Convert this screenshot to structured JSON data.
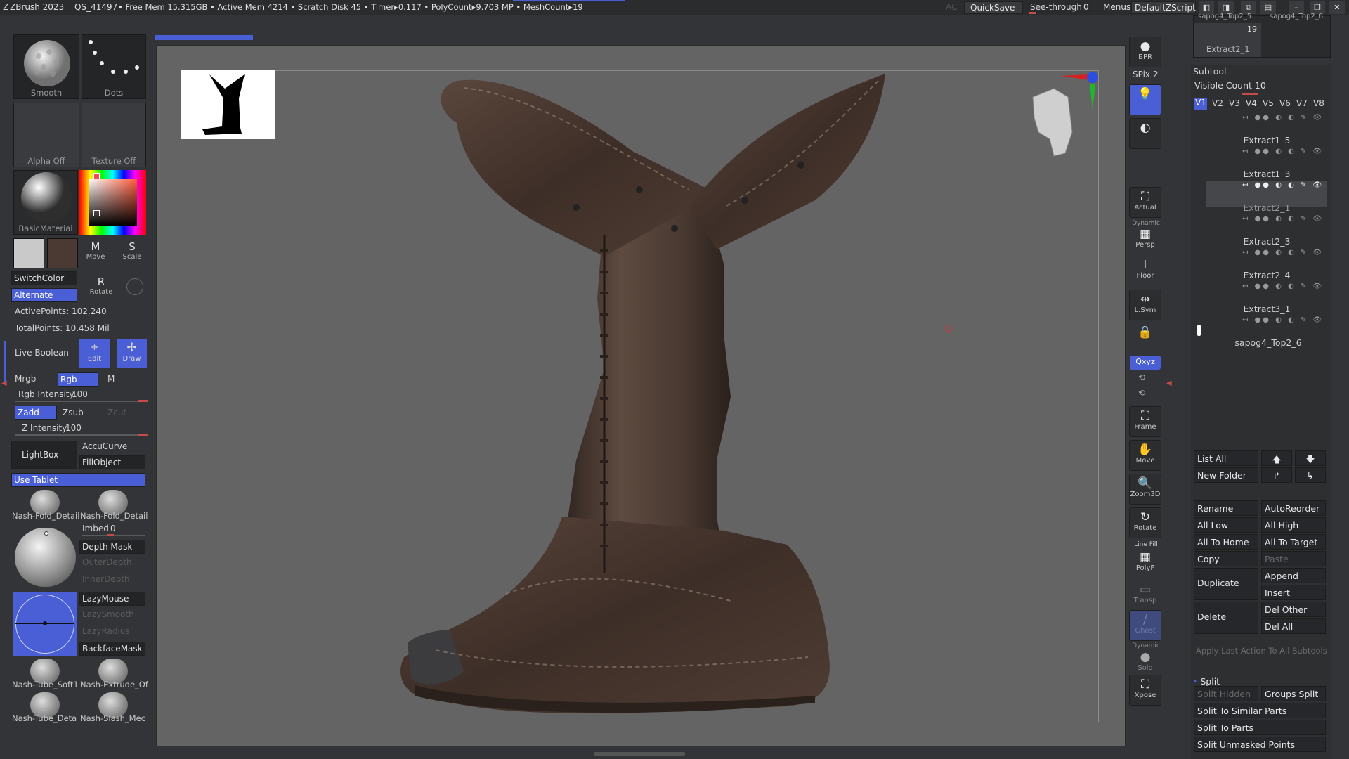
{
  "titlebar": {
    "app": "ZBrush 2023",
    "doc": "QS_41497",
    "stats": "• Free Mem 15.315GB • Active Mem 4214 • Scratch Disk 45 • Timer▸0.117 • PolyCount▸9.703 MP • MeshCount▸19",
    "ac": "AC",
    "quicksave": "QuickSave",
    "seethrough_label": "See-through",
    "seethrough_value": "0",
    "menus": "Menus",
    "script": "DefaultZScript"
  },
  "left": {
    "brush_label": "Smooth",
    "stroke_label": "Dots",
    "alpha_label": "Alpha Off",
    "texture_label": "Texture Off",
    "material_label": "BasicMaterial",
    "move_label": "Move",
    "move_key": "M",
    "scale_label": "Scale",
    "scale_key": "S",
    "rotate_label": "Rotate",
    "rotate_key": "R",
    "switch_color": "SwitchColor",
    "alternate": "Alternate",
    "active_points": "ActivePoints: 102,240",
    "total_points": "TotalPoints: 10.458 Mil",
    "live_boolean": "Live Boolean",
    "edit": "Edit",
    "draw": "Draw",
    "mrgb": "Mrgb",
    "rgb": "Rgb",
    "m": "M",
    "rgb_intensity_label": "Rgb Intensity",
    "rgb_intensity_value": "100",
    "zadd": "Zadd",
    "zsub": "Zsub",
    "zcut": "Zcut",
    "z_intensity_label": "Z Intensity",
    "z_intensity_value": "100",
    "lightbox": "LightBox",
    "accucurve": "AccuCurve",
    "fillobject": "FillObject",
    "use_tablet": "Use Tablet",
    "brushes_top": [
      "Nash-Fold_Detail",
      "Nash-Fold_Detail"
    ],
    "imbed_label": "Imbed",
    "imbed_value": "0",
    "depth_mask": "Depth Mask",
    "outer_depth": "OuterDepth",
    "inner_depth": "InnerDepth",
    "lazymouse": "LazyMouse",
    "lazysmooth": "LazySmooth",
    "lazyradius": "LazyRadius",
    "backfacemask": "BackfaceMask",
    "brushes_mid": [
      "Nash-Tube_Soft1",
      "Nash-Extrude_Of"
    ],
    "brushes_bot": [
      "Nash-Tube_Deta",
      "Nash-Slash_Mec"
    ]
  },
  "right_dock": {
    "bpr": "BPR",
    "spix_label": "SPix",
    "spix_value": "2",
    "actual": "Actual",
    "dynamic": "Dynamic",
    "persp": "Persp",
    "floor": "Floor",
    "lsym": "L.Sym",
    "xyz": "Qxyz",
    "frame": "Frame",
    "move": "Move",
    "zoom3d": "Zoom3D",
    "rotate": "Rotate",
    "line_fill": "Line Fill",
    "polyf": "PolyF",
    "transp": "Transp",
    "ghost": "Ghost",
    "dynamic_solo": "Dynamic",
    "solo": "Solo",
    "xpose": "Xpose"
  },
  "subtool": {
    "top_thumb_count": "19",
    "top_thumb_name": "Extract2_1",
    "top_partial": [
      "sapog4_Top2_5",
      "sapog4_Top2_6"
    ],
    "title": "Subtool",
    "visible_count_label": "Visible Count",
    "visible_count_value": "10",
    "versions": [
      "V1",
      "V2",
      "V3",
      "V4",
      "V5",
      "V6",
      "V7",
      "V8"
    ],
    "items": [
      "Extract1_5",
      "Extract1_3",
      "Extract2_1",
      "Extract2_3",
      "Extract2_4",
      "Extract3_1",
      "sapog4_Top2_6"
    ],
    "list_all": "List All",
    "new_folder": "New Folder",
    "rename": "Rename",
    "autoreorder": "AutoReorder",
    "all_low": "All Low",
    "all_high": "All High",
    "all_to_home": "All To Home",
    "all_to_target": "All To Target",
    "copy": "Copy",
    "paste": "Paste",
    "duplicate": "Duplicate",
    "append": "Append",
    "insert": "Insert",
    "delete": "Delete",
    "del_other": "Del Other",
    "del_all": "Del All",
    "apply_last": "Apply Last Action To All Subtools",
    "split": "Split",
    "split_hidden": "Split Hidden",
    "groups_split": "Groups Split",
    "split_similar": "Split To Similar Parts",
    "split_parts": "Split To Parts",
    "split_unmasked": "Split Unmasked Points"
  },
  "colors": {
    "accent": "#4a5fd6",
    "panel": "#2e2f31",
    "canvas": "#646464",
    "leather": "#4a3a33"
  }
}
